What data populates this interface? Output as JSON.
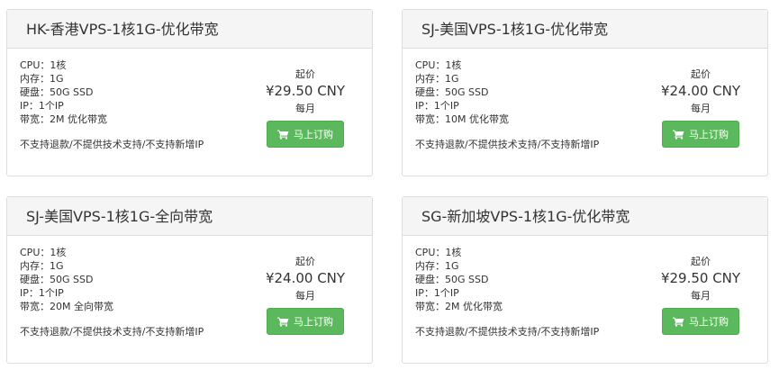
{
  "plans": [
    {
      "title": "HK-香港VPS-1核1G-优化带宽",
      "specs": [
        "CPU：1核",
        "内存：1G",
        "硬盘：50G SSD",
        "IP：1个IP",
        "带宽：2M 优化带宽"
      ],
      "note": "不支持退款/不提供技术支持/不支持新增IP",
      "from_label": "起价",
      "price": "¥29.50 CNY",
      "period": "每月",
      "button_label": "马上订购"
    },
    {
      "title": "SJ-美国VPS-1核1G-优化带宽",
      "specs": [
        "CPU：1核",
        "内存：1G",
        "硬盘：50G SSD",
        "IP：1个IP",
        "带宽：10M 优化带宽"
      ],
      "note": "不支持退款/不提供技术支持/不支持新增IP",
      "from_label": "起价",
      "price": "¥24.00 CNY",
      "period": "每月",
      "button_label": "马上订购"
    },
    {
      "title": "SJ-美国VPS-1核1G-全向带宽",
      "specs": [
        "CPU：1核",
        "内存：1G",
        "硬盘：50G SSD",
        "IP：1个IP",
        "带宽：20M 全向带宽"
      ],
      "note": "不支持退款/不提供技术支持/不支持新增IP",
      "from_label": "起价",
      "price": "¥24.00 CNY",
      "period": "每月",
      "button_label": "马上订购"
    },
    {
      "title": "SG-新加坡VPS-1核1G-优化带宽",
      "specs": [
        "CPU：1核",
        "内存：1G",
        "硬盘：50G SSD",
        "IP：1个IP",
        "带宽：2M 优化带宽"
      ],
      "note": "不支持退款/不提供技术支持/不支持新增IP",
      "from_label": "起价",
      "price": "¥29.50 CNY",
      "period": "每月",
      "button_label": "马上订购"
    }
  ],
  "button_icon": "shopping-cart-icon",
  "colors": {
    "button_bg": "#5cb85c",
    "header_bg": "#f5f5f5",
    "border": "#dddddd"
  }
}
